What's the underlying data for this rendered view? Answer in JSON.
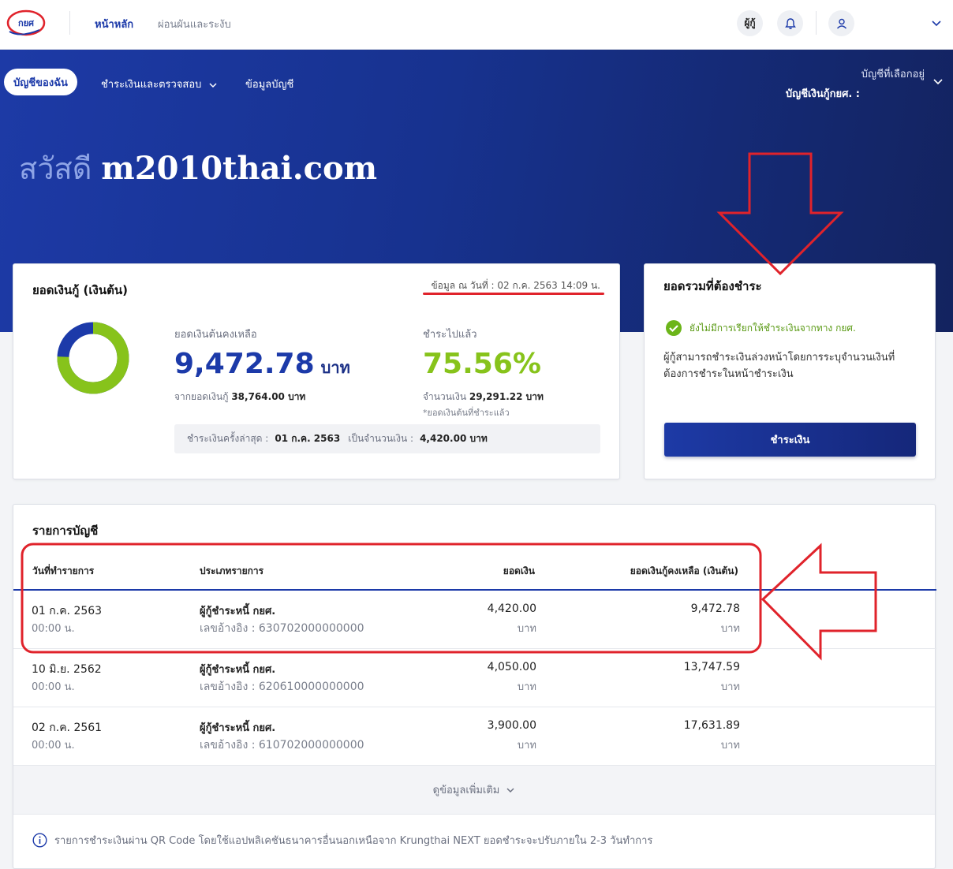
{
  "topbar": {
    "logo_text": "กยศ",
    "nav_home": "หน้าหลัก",
    "nav_relief": "ผ่อนผันและระงับ",
    "borrower_btn": "ผู้กู้"
  },
  "hero": {
    "tab_my_account": "บัญชีของฉัน",
    "tab_pay_check": "ชำระเงินและตรวจสอบ",
    "tab_account_info": "ข้อมูลบัญชี",
    "selected_account_label": "บัญชีที่เลือกอยู่",
    "selected_account_value": "บัญชีเงินกู้กยศ. :",
    "greeting": "สวัสดี",
    "user_name": "m2010thai.com"
  },
  "loan_card": {
    "title": "ยอดเงินกู้ (เงินต้น)",
    "as_of": "ข้อมูล ณ วันที่ : 02 ก.ค. 2563 14:09 น.",
    "remaining_label": "ยอดเงินต้นคงเหลือ",
    "remaining_amount": "9,472.78",
    "currency": "บาท",
    "from_total": "จากยอดเงินกู้",
    "total_amount": "38,764.00 บาท",
    "paid_label": "ชำระไปแล้ว",
    "paid_percent": "75.56%",
    "paid_fraction": 0.7556,
    "paid_amount_label": "จำนวนเงิน",
    "paid_amount": "29,291.22 บาท",
    "paid_note": "*ยอดเงินต้นที่ชำระแล้ว",
    "last_payment_label": "ชำระเงินครั้งล่าสุด :",
    "last_payment_date": "01 ก.ค. 2563",
    "last_payment_amount_label": "เป็นจำนวนเงิน :",
    "last_payment_amount": "4,420.00 บาท"
  },
  "due_card": {
    "title": "ยอดรวมที่ต้องชำระ",
    "status": "ยังไม่มีการเรียกให้ชำระเงินจากทาง กยศ.",
    "description": "ผู้กู้สามารถชำระเงินล่วงหน้าโดยการระบุจำนวนเงินที่ต้องการชำระในหน้าชำระเงิน",
    "pay_button": "ชำระเงิน"
  },
  "transactions": {
    "title": "รายการบัญชี",
    "headers": {
      "date": "วันที่ทำรายการ",
      "type": "ประเภทรายการ",
      "amount": "ยอดเงิน",
      "balance": "ยอดเงินกู้คงเหลือ (เงินต้น)"
    },
    "rows": [
      {
        "date": "01 ก.ค. 2563",
        "time": "00:00 น.",
        "type": "ผู้กู้ชำระหนี้ กยศ.",
        "ref": "เลขอ้างอิง : 630702000000000",
        "amount": "4,420.00",
        "balance": "9,472.78",
        "unit": "บาท"
      },
      {
        "date": "10 มิ.ย. 2562",
        "time": "00:00 น.",
        "type": "ผู้กู้ชำระหนี้ กยศ.",
        "ref": "เลขอ้างอิง : 620610000000000",
        "amount": "4,050.00",
        "balance": "13,747.59",
        "unit": "บาท"
      },
      {
        "date": "02 ก.ค. 2561",
        "time": "00:00 น.",
        "type": "ผู้กู้ชำระหนี้ กยศ.",
        "ref": "เลขอ้างอิง : 610702000000000",
        "amount": "3,900.00",
        "balance": "17,631.89",
        "unit": "บาท"
      }
    ],
    "more_label": "ดูข้อมูลเพิ่มเติม",
    "note": "รายการชำระเงินผ่าน QR Code โดยใช้แอปพลิเคชันธนาคารอื่นนอกเหนือจาก Krungthai NEXT ยอดชำระจะปรับภายใน 2-3 วันทำการ"
  },
  "colors": {
    "brand_blue": "#1c3aa9",
    "paid_green": "#87c31b",
    "annotation_red": "#e0232b"
  }
}
